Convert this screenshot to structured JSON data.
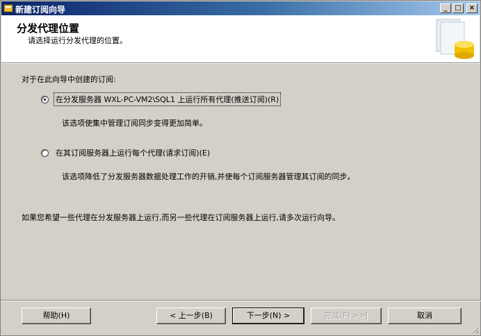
{
  "window": {
    "title": "新建订阅向导",
    "minimize_label": "_",
    "maximize_label": "□",
    "close_label": "×"
  },
  "header": {
    "title": "分发代理位置",
    "subtitle": "请选择运行分发代理的位置。"
  },
  "content": {
    "prompt": "对于在此向导中创建的订阅:",
    "option_push": {
      "label": "在分发服务器 WXL-PC-VM2\\SQL1 上运行所有代理(推送订阅)(R)",
      "selected": true,
      "description": "该选项使集中管理订阅同步变得更加简单。"
    },
    "option_pull": {
      "label": "在其订阅服务器上运行每个代理(请求订阅)(E)",
      "selected": false,
      "description": "该选项降低了分发服务器数据处理工作的开销,并使每个订阅服务器管理其订阅的同步。"
    },
    "note": "如果您希望一些代理在分发服务器上运行,而另一些代理在订阅服务器上运行,请多次运行向导。"
  },
  "buttons": {
    "help": "帮助(H)",
    "back": "< 上一步(B)",
    "next": "下一步(N) >",
    "finish": "完成(F) >>|",
    "cancel": "取消"
  }
}
